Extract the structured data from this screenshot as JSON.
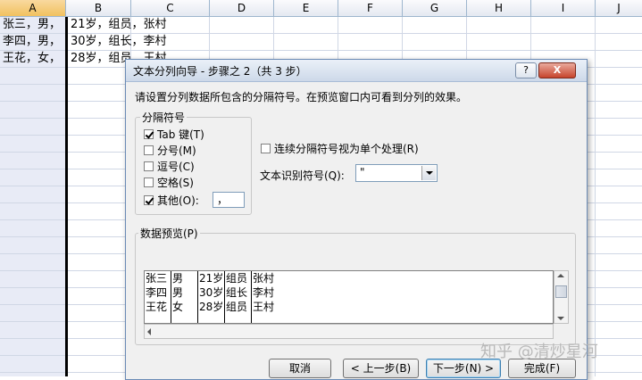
{
  "sheet": {
    "columns": [
      "A",
      "B",
      "C",
      "D",
      "E",
      "F",
      "G",
      "H",
      "I",
      "J"
    ],
    "selected_column": "A",
    "cells": {
      "A1": "张三，男，",
      "A2": "李四，男，",
      "A3": "王花，女，",
      "B1": "21岁，组员，张村",
      "B2": "30岁，组长，李村",
      "B3": "28岁，组员，王村"
    }
  },
  "dialog": {
    "title": "文本分列向导 - 步骤之 2（共 3 步）",
    "help_label": "?",
    "close_label": "X",
    "instruction": "请设置分列数据所包含的分隔符号。在预览窗口内可看到分列的效果。",
    "delimiters": {
      "group_title": "分隔符号",
      "tab": {
        "label": "Tab 键(T)",
        "checked": true
      },
      "semicolon": {
        "label": "分号(M)",
        "checked": false
      },
      "comma": {
        "label": "逗号(C)",
        "checked": false
      },
      "space": {
        "label": "空格(S)",
        "checked": false
      },
      "other": {
        "label": "其他(O):",
        "checked": true,
        "value": "，"
      }
    },
    "consecutive": {
      "label": "连续分隔符号视为单个处理(R)",
      "checked": false
    },
    "text_qualifier": {
      "label": "文本识别符号(Q):",
      "value": "\""
    },
    "preview": {
      "label": "数据预览(P)",
      "rows": [
        [
          "张三",
          "男",
          "21岁",
          "组员",
          "张村"
        ],
        [
          "李四",
          "男",
          "30岁",
          "组长",
          "李村"
        ],
        [
          "王花",
          "女",
          "28岁",
          "组员",
          "王村"
        ]
      ]
    },
    "buttons": {
      "cancel": "取消",
      "back": "< 上一步(B)",
      "next": "下一步(N) >",
      "finish": "完成(F)"
    }
  },
  "watermark": "知乎 @清炒星河"
}
